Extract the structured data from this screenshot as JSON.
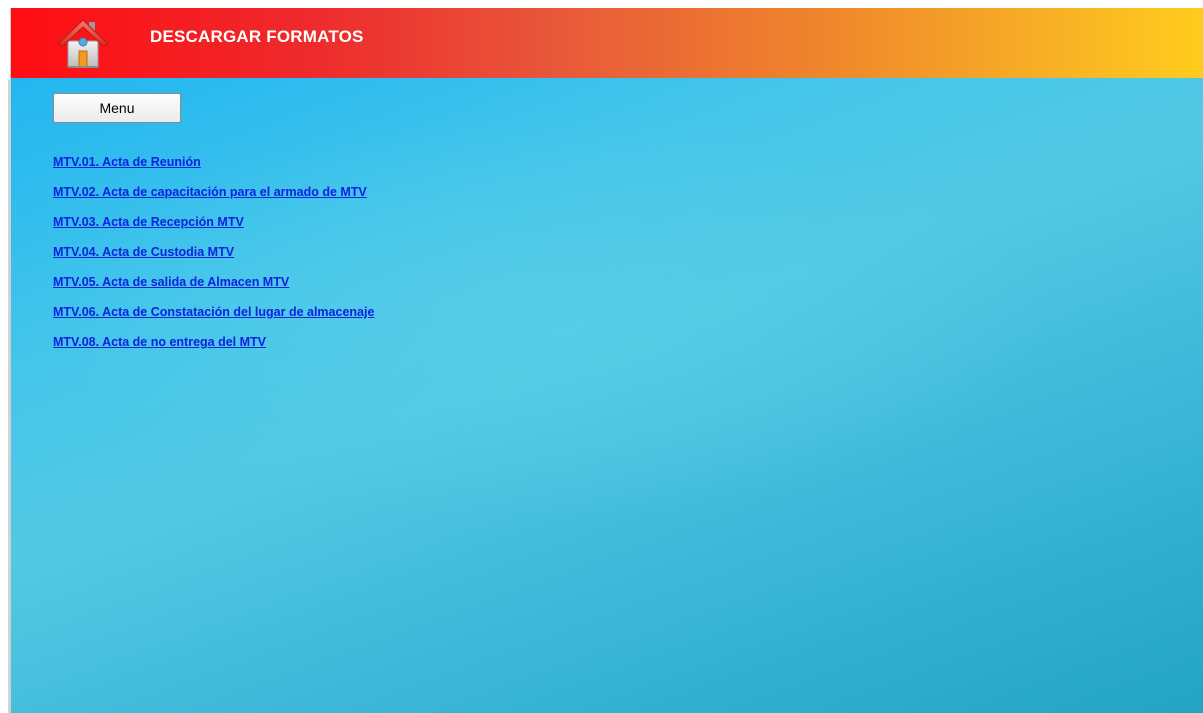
{
  "header": {
    "title": "DESCARGAR FORMATOS",
    "home_icon": "home-icon"
  },
  "menu_button": {
    "label": "Menu"
  },
  "links": [
    {
      "label": "MTV.01. Acta de Reunión"
    },
    {
      "label": "MTV.02. Acta de capacitación para el armado de MTV"
    },
    {
      "label": "MTV.03. Acta de Recepción MTV"
    },
    {
      "label": "MTV.04. Acta de Custodia MTV"
    },
    {
      "label": "MTV.05. Acta de salida de Almacen MTV"
    },
    {
      "label": "MTV.06. Acta de Constatación del lugar de almacenaje"
    },
    {
      "label": "MTV.08. Acta de no entrega del MTV"
    }
  ],
  "colors": {
    "header_start": "#ff0d12",
    "header_end": "#ffcc1c",
    "link": "#0d23e0",
    "background": "#45c6ea"
  }
}
